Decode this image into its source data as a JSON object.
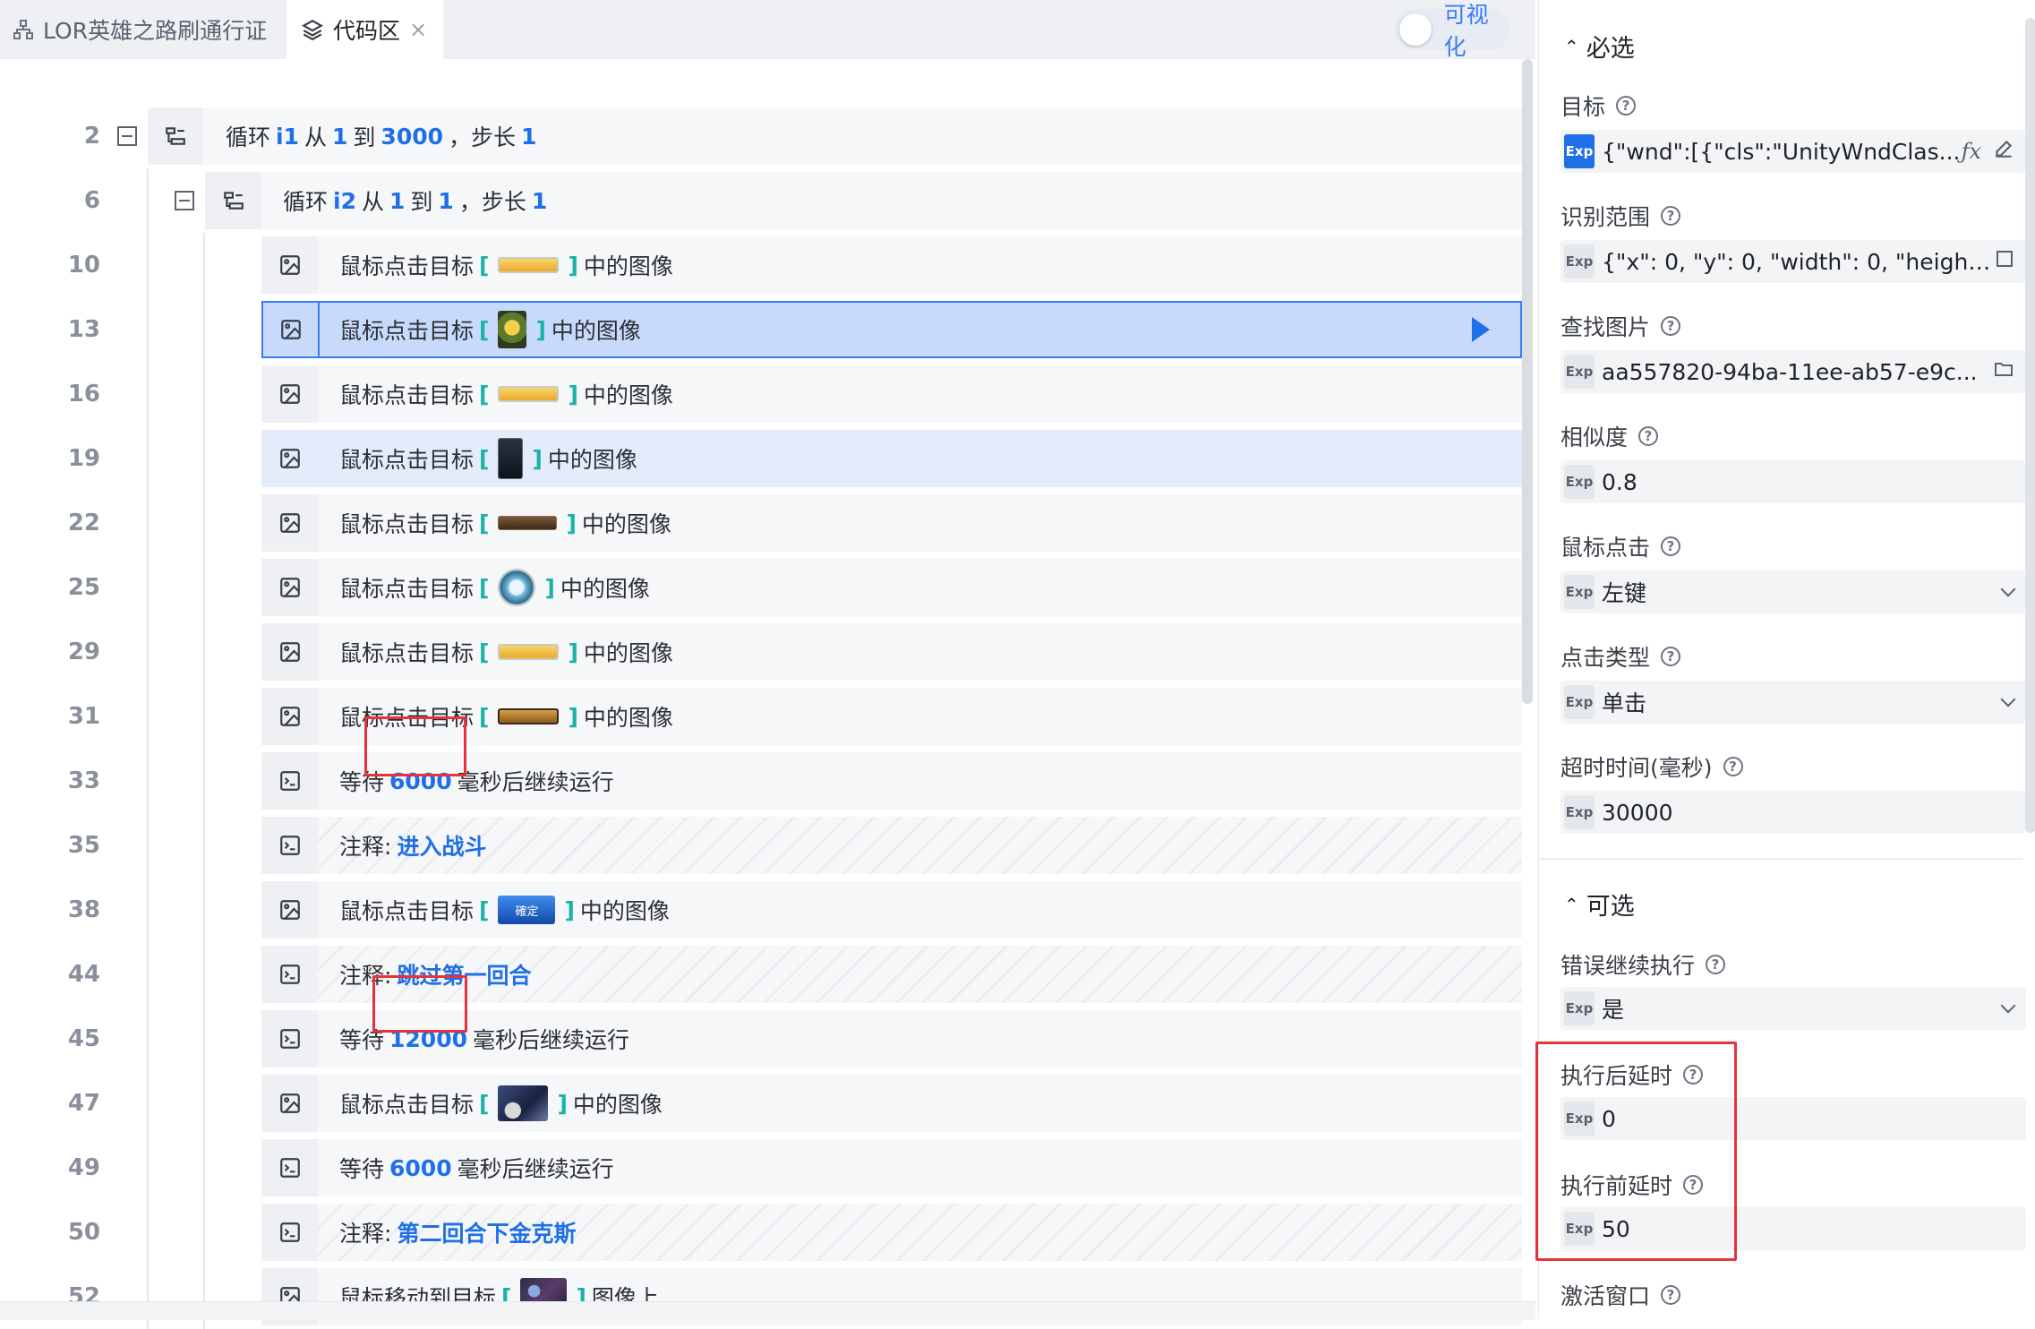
{
  "tabs": [
    {
      "label": "LOR英雄之路刷通行证",
      "icon": "flow-icon"
    },
    {
      "label": "代码区",
      "icon": "layers-icon",
      "close": "×"
    }
  ],
  "visualize_toggle": {
    "label": "可视化",
    "on": false
  },
  "code_rows": [
    {
      "line": "2",
      "kind": "loop",
      "text": {
        "p1": "循环",
        "var": "i1",
        "p2": "从",
        "from": "1",
        "p3": "到",
        "to": "3000",
        "p4": "，步长",
        "step": "1"
      }
    },
    {
      "line": "6",
      "kind": "loop",
      "text": {
        "p1": "循环",
        "var": "i2",
        "p2": "从",
        "from": "1",
        "p3": "到",
        "to": "1",
        "p4": "，步长",
        "step": "1"
      }
    },
    {
      "line": "10",
      "kind": "click",
      "text": {
        "pre": "鼠标点击目标",
        "lb": "[",
        "rb": "]",
        "post": "中的图像"
      }
    },
    {
      "line": "13",
      "kind": "click",
      "text": {
        "pre": "鼠标点击目标",
        "lb": "[",
        "rb": "]",
        "post": "中的图像"
      }
    },
    {
      "line": "16",
      "kind": "click",
      "text": {
        "pre": "鼠标点击目标",
        "lb": "[",
        "rb": "]",
        "post": "中的图像"
      }
    },
    {
      "line": "19",
      "kind": "click",
      "text": {
        "pre": "鼠标点击目标",
        "lb": "[",
        "rb": "]",
        "post": "中的图像"
      }
    },
    {
      "line": "22",
      "kind": "click",
      "text": {
        "pre": "鼠标点击目标",
        "lb": "[",
        "rb": "]",
        "post": "中的图像"
      }
    },
    {
      "line": "25",
      "kind": "click",
      "text": {
        "pre": "鼠标点击目标",
        "lb": "[",
        "rb": "]",
        "post": "中的图像"
      }
    },
    {
      "line": "29",
      "kind": "click",
      "text": {
        "pre": "鼠标点击目标",
        "lb": "[",
        "rb": "]",
        "post": "中的图像"
      }
    },
    {
      "line": "31",
      "kind": "click",
      "text": {
        "pre": "鼠标点击目标",
        "lb": "[",
        "rb": "]",
        "post": "中的图像"
      }
    },
    {
      "line": "33",
      "kind": "wait",
      "text": {
        "pre": "等待",
        "val": "6000",
        "post": "毫秒后继续运行"
      }
    },
    {
      "line": "35",
      "kind": "note",
      "text": {
        "pre": "注释:",
        "val": "进入战斗"
      }
    },
    {
      "line": "38",
      "kind": "click",
      "text": {
        "pre": "鼠标点击目标",
        "lb": "[",
        "rb": "]",
        "post": "中的图像",
        "thumb_text": "確定"
      }
    },
    {
      "line": "44",
      "kind": "note",
      "text": {
        "pre": "注释:",
        "val": "跳过第一回合"
      }
    },
    {
      "line": "45",
      "kind": "wait",
      "text": {
        "pre": "等待",
        "val": "12000",
        "post": "毫秒后继续运行"
      }
    },
    {
      "line": "47",
      "kind": "click",
      "text": {
        "pre": "鼠标点击目标",
        "lb": "[",
        "rb": "]",
        "post": "中的图像"
      }
    },
    {
      "line": "49",
      "kind": "wait",
      "text": {
        "pre": "等待",
        "val": "6000",
        "post": "毫秒后继续运行"
      }
    },
    {
      "line": "50",
      "kind": "note",
      "text": {
        "pre": "注释:",
        "val": "第二回合下金克斯"
      }
    },
    {
      "line": "52",
      "kind": "move",
      "text": {
        "pre": "鼠标移动到目标",
        "lb": "[",
        "rb": "]",
        "post": "图像上"
      }
    }
  ],
  "panel": {
    "required_title": "必选",
    "optional_title": "可选",
    "exp_badge": "Exp",
    "fields": {
      "target": {
        "label": "目标",
        "value": "{\"wnd\":[{\"cls\":\"UnityWndClas...",
        "icons": [
          "fx-icon",
          "edit-icon"
        ]
      },
      "range": {
        "label": "识别范围",
        "value": "{\"x\": 0, \"y\": 0, \"width\": 0, \"height..."
      },
      "image": {
        "label": "查找图片",
        "value": "aa557820-94ba-11ee-ab57-e9c..."
      },
      "similarity": {
        "label": "相似度",
        "value": "0.8"
      },
      "mouse_button": {
        "label": "鼠标点击",
        "value": "左键"
      },
      "click_type": {
        "label": "点击类型",
        "value": "单击"
      },
      "timeout": {
        "label": "超时时间(毫秒)",
        "value": "30000"
      },
      "continue_on_error": {
        "label": "错误继续执行",
        "value": "是"
      },
      "delay_after": {
        "label": "执行后延时",
        "value": "0"
      },
      "delay_before": {
        "label": "执行前延时",
        "value": "50"
      },
      "activate_window": {
        "label": "激活窗口"
      }
    }
  },
  "colors": {
    "accent": "#1f6fe6",
    "teal": "#18b3a6",
    "highlight_box": "#e5333b",
    "selected_row": "#c8dafb"
  }
}
